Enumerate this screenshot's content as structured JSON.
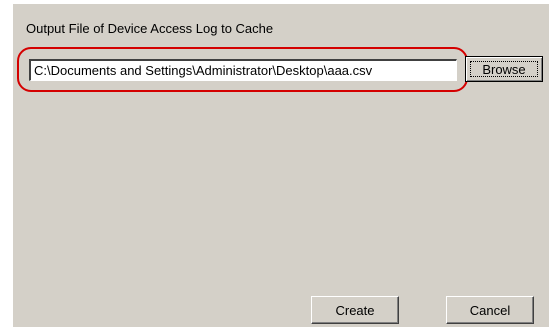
{
  "dialog": {
    "title": "Output File of Device Access Log to Cache",
    "file_path": "C:\\Documents and Settings\\Administrator\\Desktop\\aaa.csv",
    "browse_label": "Browse",
    "create_label": "Create",
    "cancel_label": "Cancel"
  },
  "colors": {
    "dialog_background": "#d4d0c8",
    "highlight_outline": "#d40000"
  }
}
